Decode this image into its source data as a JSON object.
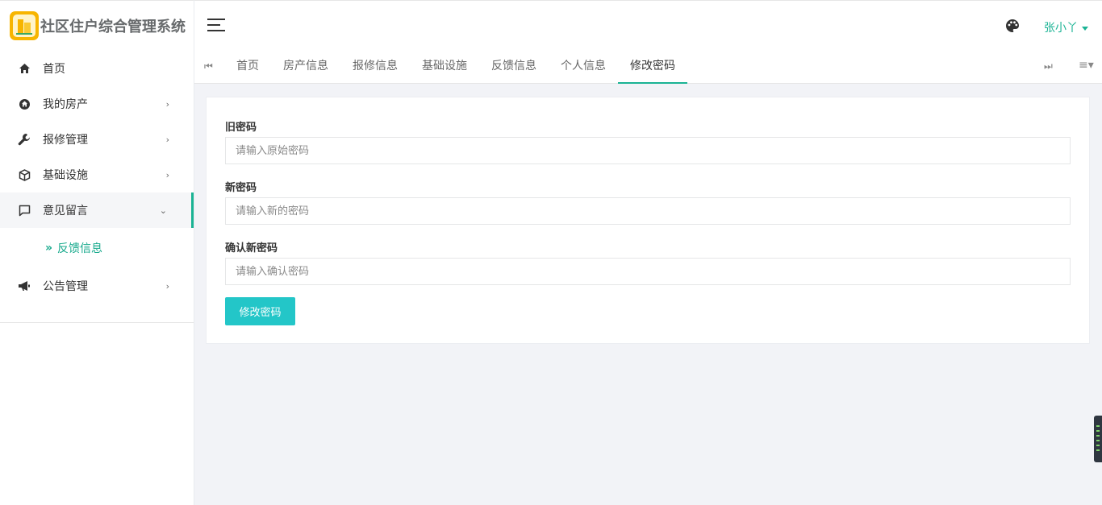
{
  "app": {
    "title": "社区住户综合管理系统"
  },
  "sidebar": {
    "items": [
      {
        "label": "首页",
        "icon": "home-icon",
        "arrow": ""
      },
      {
        "label": "我的房产",
        "icon": "house-icon",
        "arrow": "›"
      },
      {
        "label": "报修管理",
        "icon": "wrench-icon",
        "arrow": "›"
      },
      {
        "label": "基础设施",
        "icon": "cube-icon",
        "arrow": "›"
      },
      {
        "label": "意见留言",
        "icon": "comment-icon",
        "arrow": "⌄"
      },
      {
        "label": "公告管理",
        "icon": "bullhorn-icon",
        "arrow": "›"
      }
    ],
    "submenu": {
      "label": "反馈信息",
      "marker": "»"
    }
  },
  "header": {
    "user": "张小丫",
    "palette_icon": "palette-icon"
  },
  "tabs": {
    "items": [
      "首页",
      "房产信息",
      "报修信息",
      "基础设施",
      "反馈信息",
      "个人信息",
      "修改密码"
    ],
    "active": "修改密码",
    "nav_left": "⏮",
    "nav_right": "⏭",
    "menu": "≡▾"
  },
  "form": {
    "old_label": "旧密码",
    "old_placeholder": "请输入原始密码",
    "new_label": "新密码",
    "new_placeholder": "请输入新的密码",
    "confirm_label": "确认新密码",
    "confirm_placeholder": "请输入确认密码",
    "submit_label": "修改密码"
  },
  "colors": {
    "accent": "#1ab394",
    "button": "#23c6c8"
  }
}
